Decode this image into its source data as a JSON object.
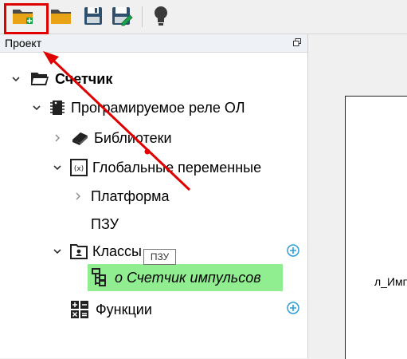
{
  "toolbar": {
    "buttons": [
      {
        "name": "new-project-icon"
      },
      {
        "name": "open-folder-icon"
      },
      {
        "name": "save-icon"
      },
      {
        "name": "save-as-icon"
      },
      {
        "name": "lightbulb-icon"
      }
    ]
  },
  "panel": {
    "title": "Проект"
  },
  "tree": {
    "root": "Счетчик",
    "device": "Програмируемое реле ОЛ",
    "libraries": "Библиотеки",
    "globals": "Глобальные переменные",
    "platform": "Платформа",
    "rom": "ПЗУ",
    "classes": "Классы",
    "selected_item": "o Счетчик импульсов",
    "functions": "Функции"
  },
  "tooltip": {
    "text": "ПЗУ"
  },
  "canvas": {
    "partial_text": "л_Имп"
  },
  "colors": {
    "selection": "#90ee90",
    "annotation": "#e00000",
    "add_button": "#2a9fd6"
  }
}
